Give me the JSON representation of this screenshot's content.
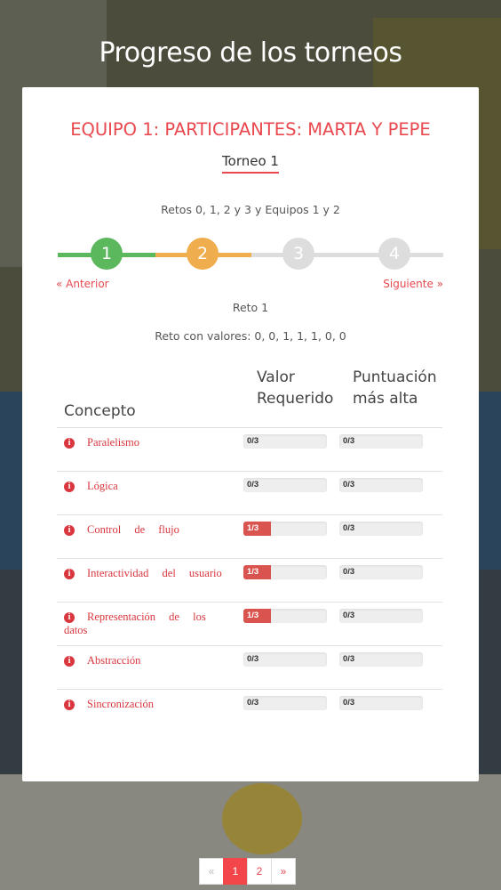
{
  "page_title": "Progreso de los torneos",
  "team_title": "EQUIPO 1: PARTICIPANTES: MARTA Y PEPE",
  "tournament_name": "Torneo 1",
  "rounds_description": "Retos 0, 1, 2 y 3 y Equipos 1 y 2",
  "steps": [
    {
      "label": "1",
      "state": "done",
      "color": "#5cb85c"
    },
    {
      "label": "2",
      "state": "current",
      "color": "#f0ad4e"
    },
    {
      "label": "3",
      "state": "pending",
      "color": "#dddddd"
    },
    {
      "label": "4",
      "state": "pending",
      "color": "#dddddd"
    }
  ],
  "nav": {
    "previous": "« Anterior",
    "next": "Siguiente »"
  },
  "current_round": "Reto 1",
  "round_values": "Reto con valores: 0, 0, 1, 1, 1, 0, 0",
  "table": {
    "headers": {
      "concept": "Concepto",
      "required": [
        "Valor",
        "Requerido"
      ],
      "best": [
        "Puntuación",
        "más alta"
      ]
    },
    "rows": [
      {
        "concept": "Paralelismo",
        "required": "0/3",
        "required_value": 0,
        "best": "0/3",
        "best_value": 0
      },
      {
        "concept": "Lógica",
        "required": "0/3",
        "required_value": 0,
        "best": "0/3",
        "best_value": 0
      },
      {
        "concept": "Control de flujo",
        "required": "1/3",
        "required_value": 1,
        "best": "0/3",
        "best_value": 0
      },
      {
        "concept": "Interactividad del usuario",
        "required": "1/3",
        "required_value": 1,
        "best": "0/3",
        "best_value": 0
      },
      {
        "concept": "Representación de los datos",
        "required": "1/3",
        "required_value": 1,
        "best": "0/3",
        "best_value": 0
      },
      {
        "concept": "Abstracción",
        "required": "0/3",
        "required_value": 0,
        "best": "0/3",
        "best_value": 0
      },
      {
        "concept": "Sincronización",
        "required": "0/3",
        "required_value": 0,
        "best": "0/3",
        "best_value": 0
      }
    ],
    "max_value": 3,
    "icon": "info-icon",
    "accent": "#d9363e"
  },
  "pagination": {
    "prev": "«",
    "pages": [
      "1",
      "2"
    ],
    "active": "1",
    "next": "»"
  }
}
